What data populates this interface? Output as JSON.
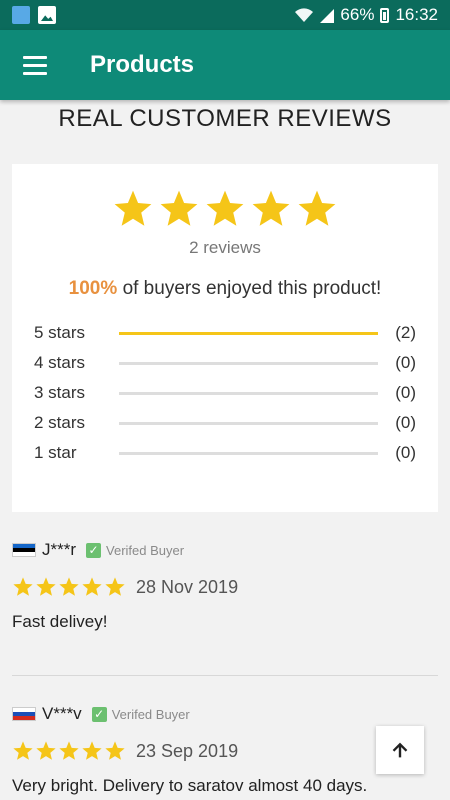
{
  "status_bar": {
    "battery": "66%",
    "time": "16:32"
  },
  "app_bar": {
    "title": "Products",
    "menu_icon": "hamburger-menu-icon"
  },
  "section_title": "REAL CUSTOMER REVIEWS",
  "summary": {
    "rating_stars": 5,
    "reviews_count_text": "2 reviews",
    "enjoyed_percent": "100%",
    "enjoyed_text": "of buyers enjoyed this product!",
    "distribution": [
      {
        "label": "5 stars",
        "count": "(2)",
        "fraction": 1.0
      },
      {
        "label": "4 stars",
        "count": "(0)",
        "fraction": 0
      },
      {
        "label": "3 stars",
        "count": "(0)",
        "fraction": 0
      },
      {
        "label": "2 stars",
        "count": "(0)",
        "fraction": 0
      },
      {
        "label": "1 star",
        "count": "(0)",
        "fraction": 0
      }
    ]
  },
  "reviews": [
    {
      "name": "J***r",
      "flag": "estonia",
      "verified_label": "Verifed Buyer",
      "stars": 5,
      "date": "28 Nov 2019",
      "text": "Fast delivey!"
    },
    {
      "name": "V***v",
      "flag": "russia",
      "verified_label": "Verifed Buyer",
      "stars": 5,
      "date": "23 Sep 2019",
      "text": "Very bright. Delivery to saratov almost 40 days."
    }
  ],
  "colors": {
    "status_bar": "#0b6b5c",
    "app_bar": "#0e8a78",
    "star": "#f5c518",
    "percent": "#e8913f",
    "verified_check": "#6cc070"
  }
}
